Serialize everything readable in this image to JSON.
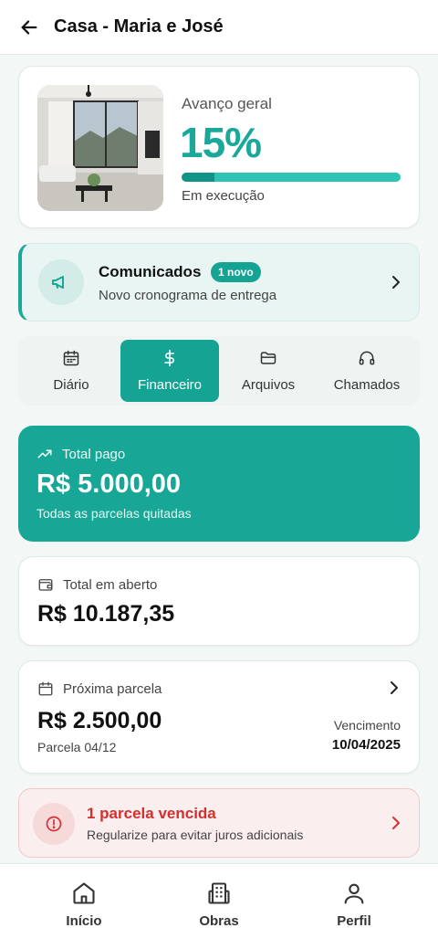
{
  "header": {
    "title": "Casa - Maria e José"
  },
  "progress": {
    "label": "Avanço geral",
    "value": "15%",
    "fraction": 0.15,
    "status": "Em execução"
  },
  "announcement": {
    "title": "Comunicados",
    "badge": "1 novo",
    "subtitle": "Novo cronograma de entrega"
  },
  "tabs": [
    {
      "label": "Diário",
      "icon": "calendar-icon",
      "active": false
    },
    {
      "label": "Financeiro",
      "icon": "dollar-icon",
      "active": true
    },
    {
      "label": "Arquivos",
      "icon": "folder-icon",
      "active": false
    },
    {
      "label": "Chamados",
      "icon": "headphones-icon",
      "active": false
    }
  ],
  "finance": {
    "paid": {
      "label": "Total pago",
      "amount": "R$ 5.000,00",
      "subtitle": "Todas as parcelas quitadas",
      "icon": "trending-up-icon"
    },
    "open": {
      "label": "Total em aberto",
      "amount": "R$ 10.187,35",
      "icon": "wallet-icon"
    },
    "next": {
      "label": "Próxima parcela",
      "amount": "R$ 2.500,00",
      "installment": "Parcela 04/12",
      "due_label": "Vencimento",
      "due_date": "10/04/2025",
      "icon": "calendar-icon"
    }
  },
  "alert": {
    "title": "1 parcela vencida",
    "subtitle": "Regularize para evitar juros adicionais",
    "icon": "alert-circle-icon"
  },
  "bottom_nav": [
    {
      "label": "Início",
      "icon": "home-icon"
    },
    {
      "label": "Obras",
      "icon": "buildings-icon"
    },
    {
      "label": "Perfil",
      "icon": "user-icon"
    }
  ],
  "colors": {
    "accent": "#18a797",
    "accent_dark": "#119488",
    "danger": "#d32f2f",
    "background": "#f3f8f7"
  }
}
